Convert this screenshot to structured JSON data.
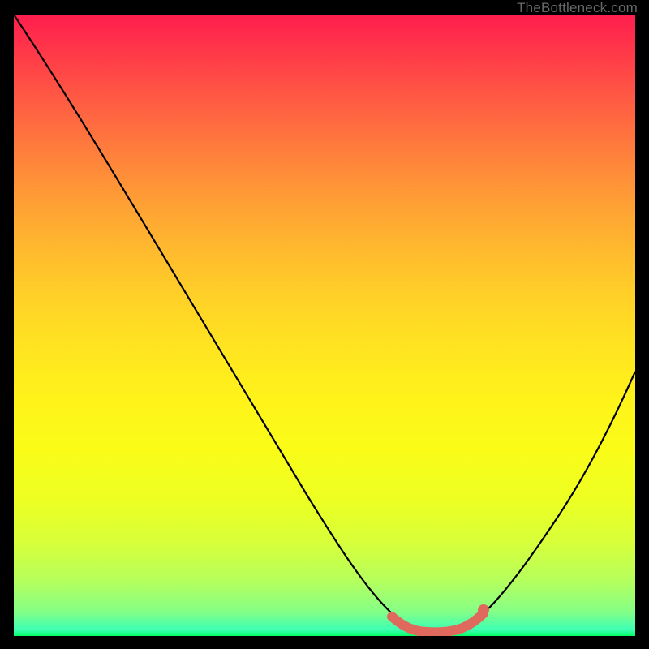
{
  "watermark": "TheBottleneck.com",
  "chart_data": {
    "type": "line",
    "title": "",
    "xlabel": "",
    "ylabel": "",
    "xlim": [
      0,
      100
    ],
    "ylim": [
      0,
      100
    ],
    "grid": false,
    "legend": false,
    "background_gradient": {
      "direction": "vertical",
      "stops": [
        {
          "pos": 0,
          "color": "#ff1e4e"
        },
        {
          "pos": 50,
          "color": "#ffe520"
        },
        {
          "pos": 100,
          "color": "#00ff66"
        }
      ]
    },
    "series": [
      {
        "name": "bottleneck-curve",
        "color": "#000000",
        "x": [
          0,
          5,
          10,
          15,
          20,
          25,
          30,
          35,
          40,
          45,
          50,
          55,
          60,
          63,
          66,
          70,
          73,
          76,
          80,
          85,
          90,
          95,
          100
        ],
        "y": [
          100,
          92,
          84,
          76,
          67,
          59,
          51,
          43,
          34,
          26,
          18,
          10,
          4,
          2,
          1,
          1,
          2,
          4,
          9,
          17,
          26,
          35,
          45
        ]
      },
      {
        "name": "optimal-segment",
        "color": "#e0695e",
        "style": "thick-rounded",
        "x": [
          62,
          64,
          66,
          68,
          70,
          72,
          74,
          75.5
        ],
        "y": [
          4,
          2.5,
          1.5,
          1,
          1,
          1.2,
          1.8,
          3
        ]
      },
      {
        "name": "optimal-endpoint-marker",
        "color": "#e0695e",
        "style": "dot",
        "x": [
          75.5
        ],
        "y": [
          3
        ]
      }
    ]
  }
}
